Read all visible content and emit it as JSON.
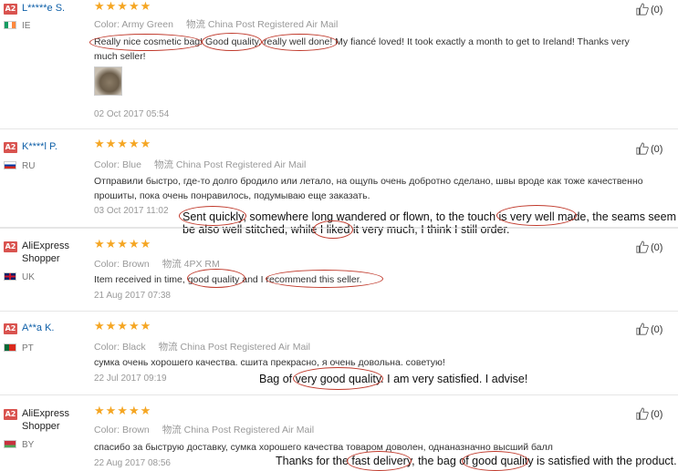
{
  "reviews": [
    {
      "badge": "A2",
      "name": "L*****e S.",
      "country": "IE",
      "flag": "flag-ie",
      "stars": "★★★★★",
      "meta": {
        "color_label": "Color:",
        "color": "Army Green",
        "shipping_icon": "物流",
        "shipping": "China Post Registered Air Mail"
      },
      "text": "Really nice cosmetic bag! Good quality, really well done! My fiancé loved! It took exactly a month to get to Ireland! Thanks very much seller!",
      "date": "02 Oct 2017 05:54",
      "helpful": "(0)"
    },
    {
      "badge": "A2",
      "name": "K****l P.",
      "country": "RU",
      "flag": "flag-ru",
      "stars": "★★★★★",
      "meta": {
        "color_label": "Color:",
        "color": "Blue",
        "shipping_icon": "物流",
        "shipping": "China Post Registered Air Mail"
      },
      "text": "Отправили быстро, где-то долго бродило или летало, на ощупь очень добротно сделано, швы вроде как тоже качественно прошиты, пока очень понравилось, подумываю еще заказать.",
      "date": "03 Oct 2017 11:02",
      "helpful": "(0)",
      "translation_1": "Sent quickly, somewhere long wandered or flown, to the touch is very well made, the seams seem to",
      "translation_2": "be also well stitched, while I liked it very much, I think I still order."
    },
    {
      "badge": "A2",
      "name": "AliExpress Shopper",
      "country": "UK",
      "flag": "flag-uk",
      "stars": "★★★★★",
      "meta": {
        "color_label": "Color:",
        "color": "Brown",
        "shipping_icon": "物流",
        "shipping": "4PX RM"
      },
      "text": "Item received in time, good quality and I recommend this seller.",
      "date": "21 Aug 2017 07:38",
      "helpful": "(0)"
    },
    {
      "badge": "A2",
      "name": "A**a K.",
      "country": "PT",
      "flag": "flag-pt",
      "stars": "★★★★★",
      "meta": {
        "color_label": "Color:",
        "color": "Black",
        "shipping_icon": "物流",
        "shipping": "China Post Registered Air Mail"
      },
      "text": "сумка очень хорошего качества. сшита прекрасно, я очень довольна. советую!",
      "date": "22 Jul 2017 09:19",
      "helpful": "(0)",
      "translation_1": "Bag of very good quality. I am very satisfied. I advise!"
    },
    {
      "badge": "A2",
      "name": "AliExpress Shopper",
      "country": "BY",
      "flag": "flag-by",
      "stars": "★★★★★",
      "meta": {
        "color_label": "Color:",
        "color": "Brown",
        "shipping_icon": "物流",
        "shipping": "China Post Registered Air Mail"
      },
      "text": "спасибо за быструю доставку, сумка хорошего качества товаром доволен, однаназначно высший балл",
      "date": "22 Aug 2017 08:56",
      "helpful": "(0)",
      "translation_1": "Thanks for the fast delivery, the bag of good quality is satisfied with the product."
    }
  ],
  "colors": {
    "badge": "#d9534f",
    "link": "#0e5fa8",
    "star": "#f5a623",
    "highlight_oval": "#c0392b"
  }
}
